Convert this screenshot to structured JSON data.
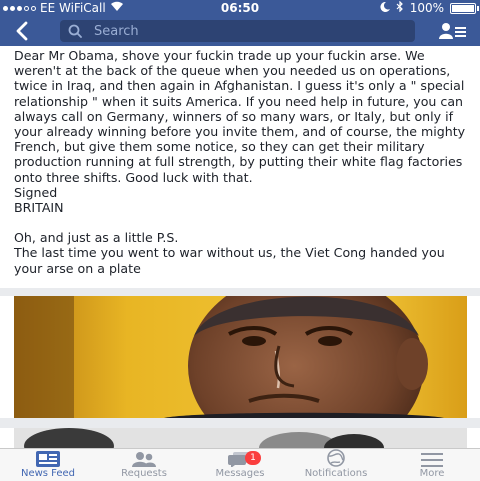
{
  "status_bar": {
    "carrier": "EE WiFiCall",
    "time": "06:50",
    "battery": "100%",
    "battery_level": 1.0
  },
  "nav": {
    "search_placeholder": "Search"
  },
  "post": {
    "paragraph_1": "Dear Mr Obama, shove your fuckin trade up your fuckin arse. We weren't at the back of the queue when you needed us on operations, twice in Iraq, and then again in Afghanistan. I guess it's only a \" special relationship \" when it suits America. If you need help in future, you can always call on Germany, winners of so many wars, or Italy, but only if your already winning before you invite them, and of course, the mighty French, but give them some notice, so they can get their military production running at full strength, by putting their white flag factories onto three shifts. Good luck with that.",
    "signed": "Signed",
    "signature": "BRITAIN",
    "ps_intro": "Oh, and just as a little P.S.",
    "ps_body": "The last time you went to war without us, the Viet Cong handed you your arse on a plate"
  },
  "tabs": [
    {
      "label": "News Feed",
      "icon": "news-feed-icon",
      "active": true
    },
    {
      "label": "Requests",
      "icon": "requests-icon"
    },
    {
      "label": "Messages",
      "icon": "messages-icon",
      "badge": "1"
    },
    {
      "label": "Notifications",
      "icon": "notifications-icon"
    },
    {
      "label": "More",
      "icon": "more-icon"
    }
  ],
  "colors": {
    "brand": "#3b5998",
    "active_tab": "#4267b2",
    "badge": "#fa3e3e"
  }
}
